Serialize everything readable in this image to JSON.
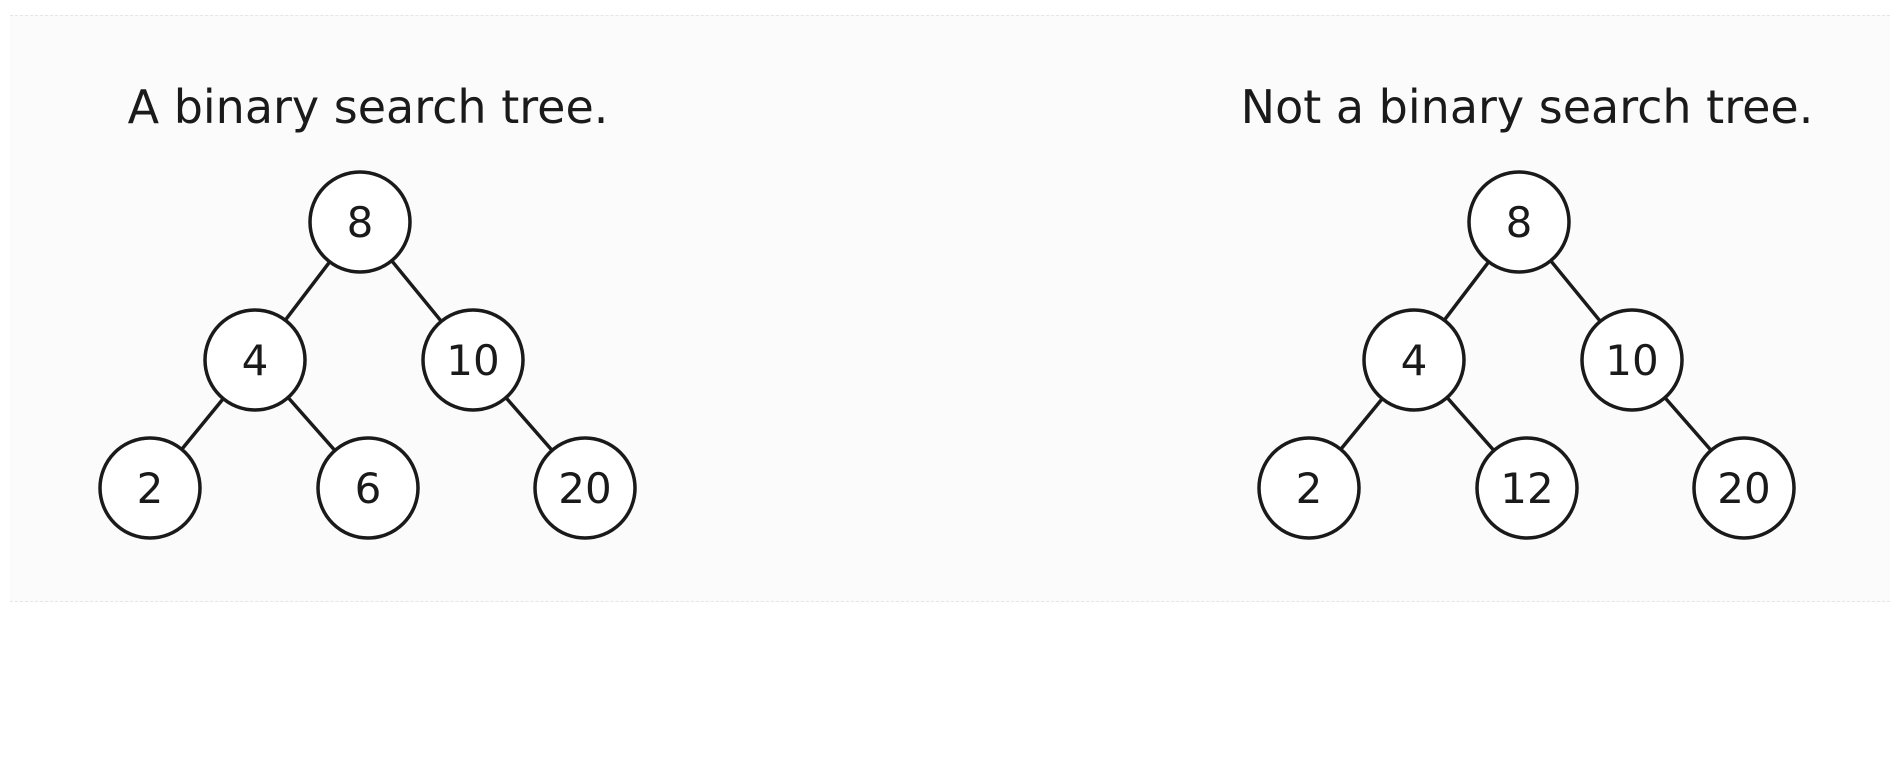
{
  "trees": [
    {
      "id": "bst",
      "title": "A binary search tree.",
      "nodes": [
        {
          "id": "n8",
          "label": "8"
        },
        {
          "id": "n4",
          "label": "4"
        },
        {
          "id": "n10",
          "label": "10"
        },
        {
          "id": "n2",
          "label": "2"
        },
        {
          "id": "n6",
          "label": "6"
        },
        {
          "id": "n20",
          "label": "20"
        }
      ],
      "edges": [
        [
          "n8",
          "n4"
        ],
        [
          "n8",
          "n10"
        ],
        [
          "n4",
          "n2"
        ],
        [
          "n4",
          "n6"
        ],
        [
          "n10",
          "n20"
        ]
      ]
    },
    {
      "id": "not-bst",
      "title": "Not a binary search tree.",
      "nodes": [
        {
          "id": "n8",
          "label": "8"
        },
        {
          "id": "n4",
          "label": "4"
        },
        {
          "id": "n10",
          "label": "10"
        },
        {
          "id": "n2",
          "label": "2"
        },
        {
          "id": "n12",
          "label": "12"
        },
        {
          "id": "n20",
          "label": "20"
        }
      ],
      "edges": [
        [
          "n8",
          "n4"
        ],
        [
          "n8",
          "n10"
        ],
        [
          "n4",
          "n2"
        ],
        [
          "n4",
          "n12"
        ],
        [
          "n10",
          "n20"
        ]
      ]
    }
  ]
}
